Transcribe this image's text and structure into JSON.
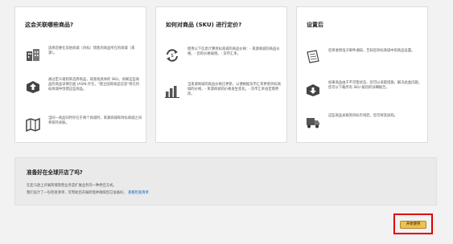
{
  "cards": [
    {
      "title": "这会关联哪些商品?",
      "items": [
        {
          "icon": "buildings-icon",
          "text": "选择您要在其他商城（目标）销售的商品所在的商城（来源）。"
        },
        {
          "icon": "upload-box-icon",
          "text": "通过定义规则来选择商品，或查找具体的 SKU。如果这些商品的商品详情页面 (ASIN 存在，\"建立国际商品信息\"将在目标商城中创建这些商品。"
        },
        {
          "icon": "map-icon",
          "text": "当同一商品同时存在于两个商城时，来源商城和目标商城之间将保持关联。"
        }
      ]
    },
    {
      "title": "如何对商品 (SKU) 进行定价?",
      "items": [
        {
          "icon": "currency-exchange-icon",
          "text": "使用以下信息计算目标商城的商品价格：- 来源商城的商品价格。- 您的价格规则。- 货币汇率。"
        },
        {
          "icon": "bar-chart-icon",
          "text": "当来源商城的商品价格已更新，以便根据货币汇率更新目标商城的价格。- 来源商城的价格发生变化。- 货币汇率会定期更改。"
        }
      ]
    },
    {
      "title": "设置后",
      "items": [
        {
          "icon": "document-edit-icon",
          "text": "您将收到电子邮件通知，告知您目标商城中的商品设置。"
        },
        {
          "icon": "download-box-icon",
          "text": "如果商品由于不可售状态、您可以采取措施，解决此类问题。您可以下载所有 SKU 级别的详细报告。"
        },
        {
          "icon": "truck-icon",
          "text": "这些商品关联到目标市场后，您可将其加购。"
        }
      ]
    }
  ],
  "banner": {
    "title": "准备好在全球开店了吗?",
    "line1": "在亚马逊上开展跨境销售业务是扩展业务的一种绝佳方式。",
    "line2": "我们设计了一份检查清单，可帮助您开展跨境并确保您已准备好。",
    "link": "查看检查清单"
  },
  "start_button": "开始使用",
  "colors": {
    "highlight": "#e00000",
    "button_bg": "#f0c14b",
    "link": "#0066c0"
  }
}
